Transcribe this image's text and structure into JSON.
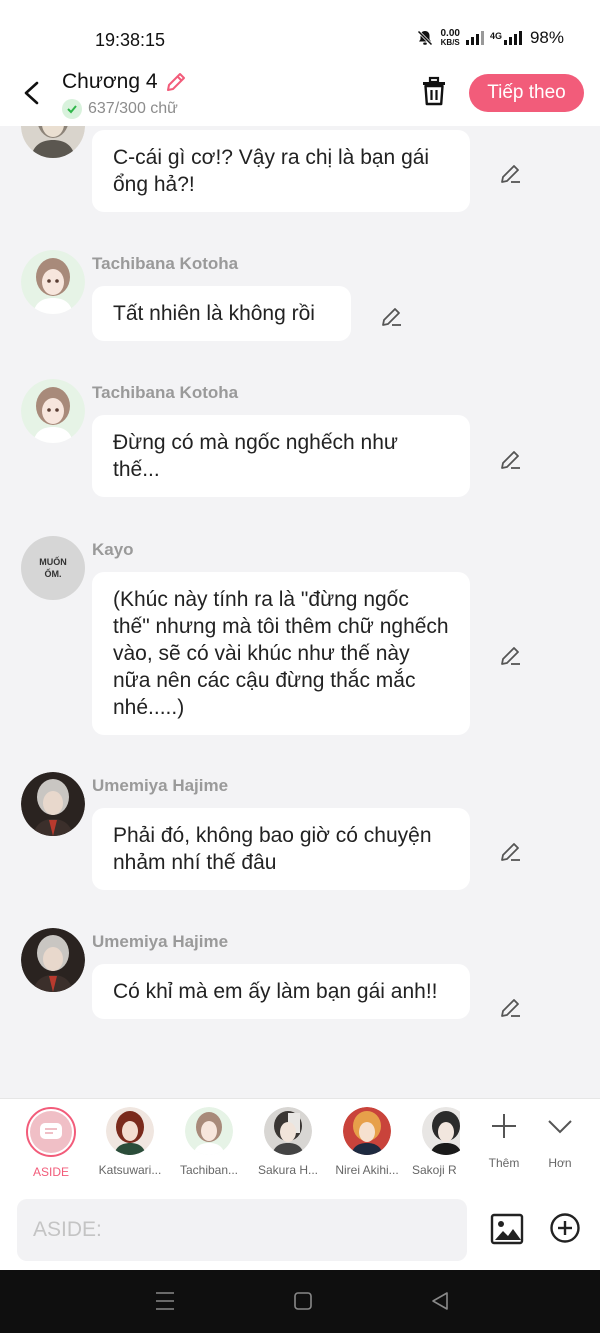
{
  "status": {
    "time": "19:38:15",
    "net_speed_value": "0.00",
    "net_speed_unit": "KB/S",
    "network": "4G",
    "battery": "98%"
  },
  "header": {
    "title": "Chương 4",
    "word_count": "637/300 chữ",
    "next_label": "Tiếp theo"
  },
  "messages": [
    {
      "sender": "",
      "text": "C-cái gì cơ!? Vậy ra chị là bạn gái ổng hả?!"
    },
    {
      "sender": "Tachibana Kotoha",
      "text": "Tất nhiên là không rồi"
    },
    {
      "sender": "Tachibana Kotoha",
      "text": "Đừng có mà ngốc nghếch như thế..."
    },
    {
      "sender": "Kayo",
      "avatar_text": "MUỐN ỐM.",
      "text": "(Khúc này tính ra là \"đừng ngốc thế\" nhưng mà tôi thêm chữ nghếch vào, sẽ có vài khúc như thế này nữa nên các cậu đừng thắc mắc nhé.....)"
    },
    {
      "sender": "Umemiya Hajime",
      "text": "Phải đó, không bao giờ có chuyện nhảm nhí thế đâu"
    },
    {
      "sender": "Umemiya Hajime",
      "text": "Có khỉ mà em ấy làm bạn gái anh!!"
    }
  ],
  "characters": [
    {
      "name": "ASIDE",
      "color": "#f25c7a"
    },
    {
      "name": "Katsuwari..."
    },
    {
      "name": "Tachiban..."
    },
    {
      "name": "Sakura H..."
    },
    {
      "name": "Nirei Akihi..."
    },
    {
      "name": "Sakoji R"
    }
  ],
  "tools": {
    "add_label": "Thêm",
    "more_label": "Hơn"
  },
  "input": {
    "placeholder": "ASIDE:"
  },
  "colors": {
    "accent": "#f25c7a",
    "background": "#f3f3f5",
    "bubble": "#ffffff"
  }
}
